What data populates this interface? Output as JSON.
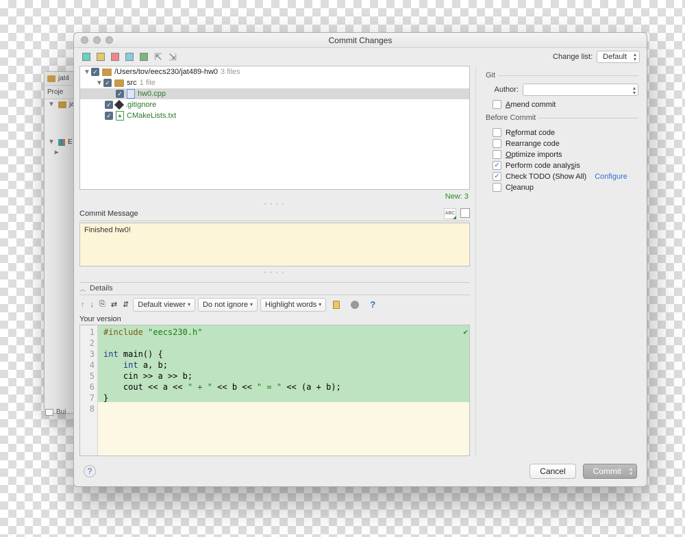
{
  "titlebar": {
    "title": "Commit Changes"
  },
  "changelist": {
    "label": "Change list:",
    "value": "Default"
  },
  "tree": {
    "root": {
      "path": "/Users/tov/eecs230/jat489-hw0",
      "count": "3 files"
    },
    "src": {
      "name": "src",
      "count": "1 file"
    },
    "files": {
      "hw0": "hw0.cpp",
      "gitignore": ".gitignore",
      "cmake": "CMakeLists.txt"
    }
  },
  "new_count": "New: 3",
  "commit_section": {
    "label": "Commit Message"
  },
  "commit_message": "Finished hw0!",
  "details": {
    "label": "Details"
  },
  "diff_toolbar": {
    "viewer": "Default viewer",
    "ignore": "Do not ignore",
    "highlight": "Highlight words"
  },
  "your_version": "Your version",
  "code": {
    "l1": "#include \"eecs230.h\"",
    "l2": "",
    "l3": "int main() {",
    "l4": "    int a, b;",
    "l5": "    cin >> a >> b;",
    "l6": "    cout << a << \" + \" << b << \" = \" << (a + b);",
    "l7": "}"
  },
  "git": {
    "section": "Git",
    "author_label": "Author:",
    "amend": "Amend commit"
  },
  "before_commit": {
    "section": "Before Commit",
    "reformat": "Reformat code",
    "rearrange": "Rearrange code",
    "optimize": "Optimize imports",
    "analysis": "Perform code analysis",
    "todo": "Check TODO (Show All)",
    "configure": "Configure",
    "cleanup": "Cleanup"
  },
  "buttons": {
    "cancel": "Cancel",
    "commit": "Commit"
  },
  "bg": {
    "tab1": "jat4",
    "proj": "Proje",
    "folder": "ja",
    "ext": "E",
    "status": "Bui"
  }
}
